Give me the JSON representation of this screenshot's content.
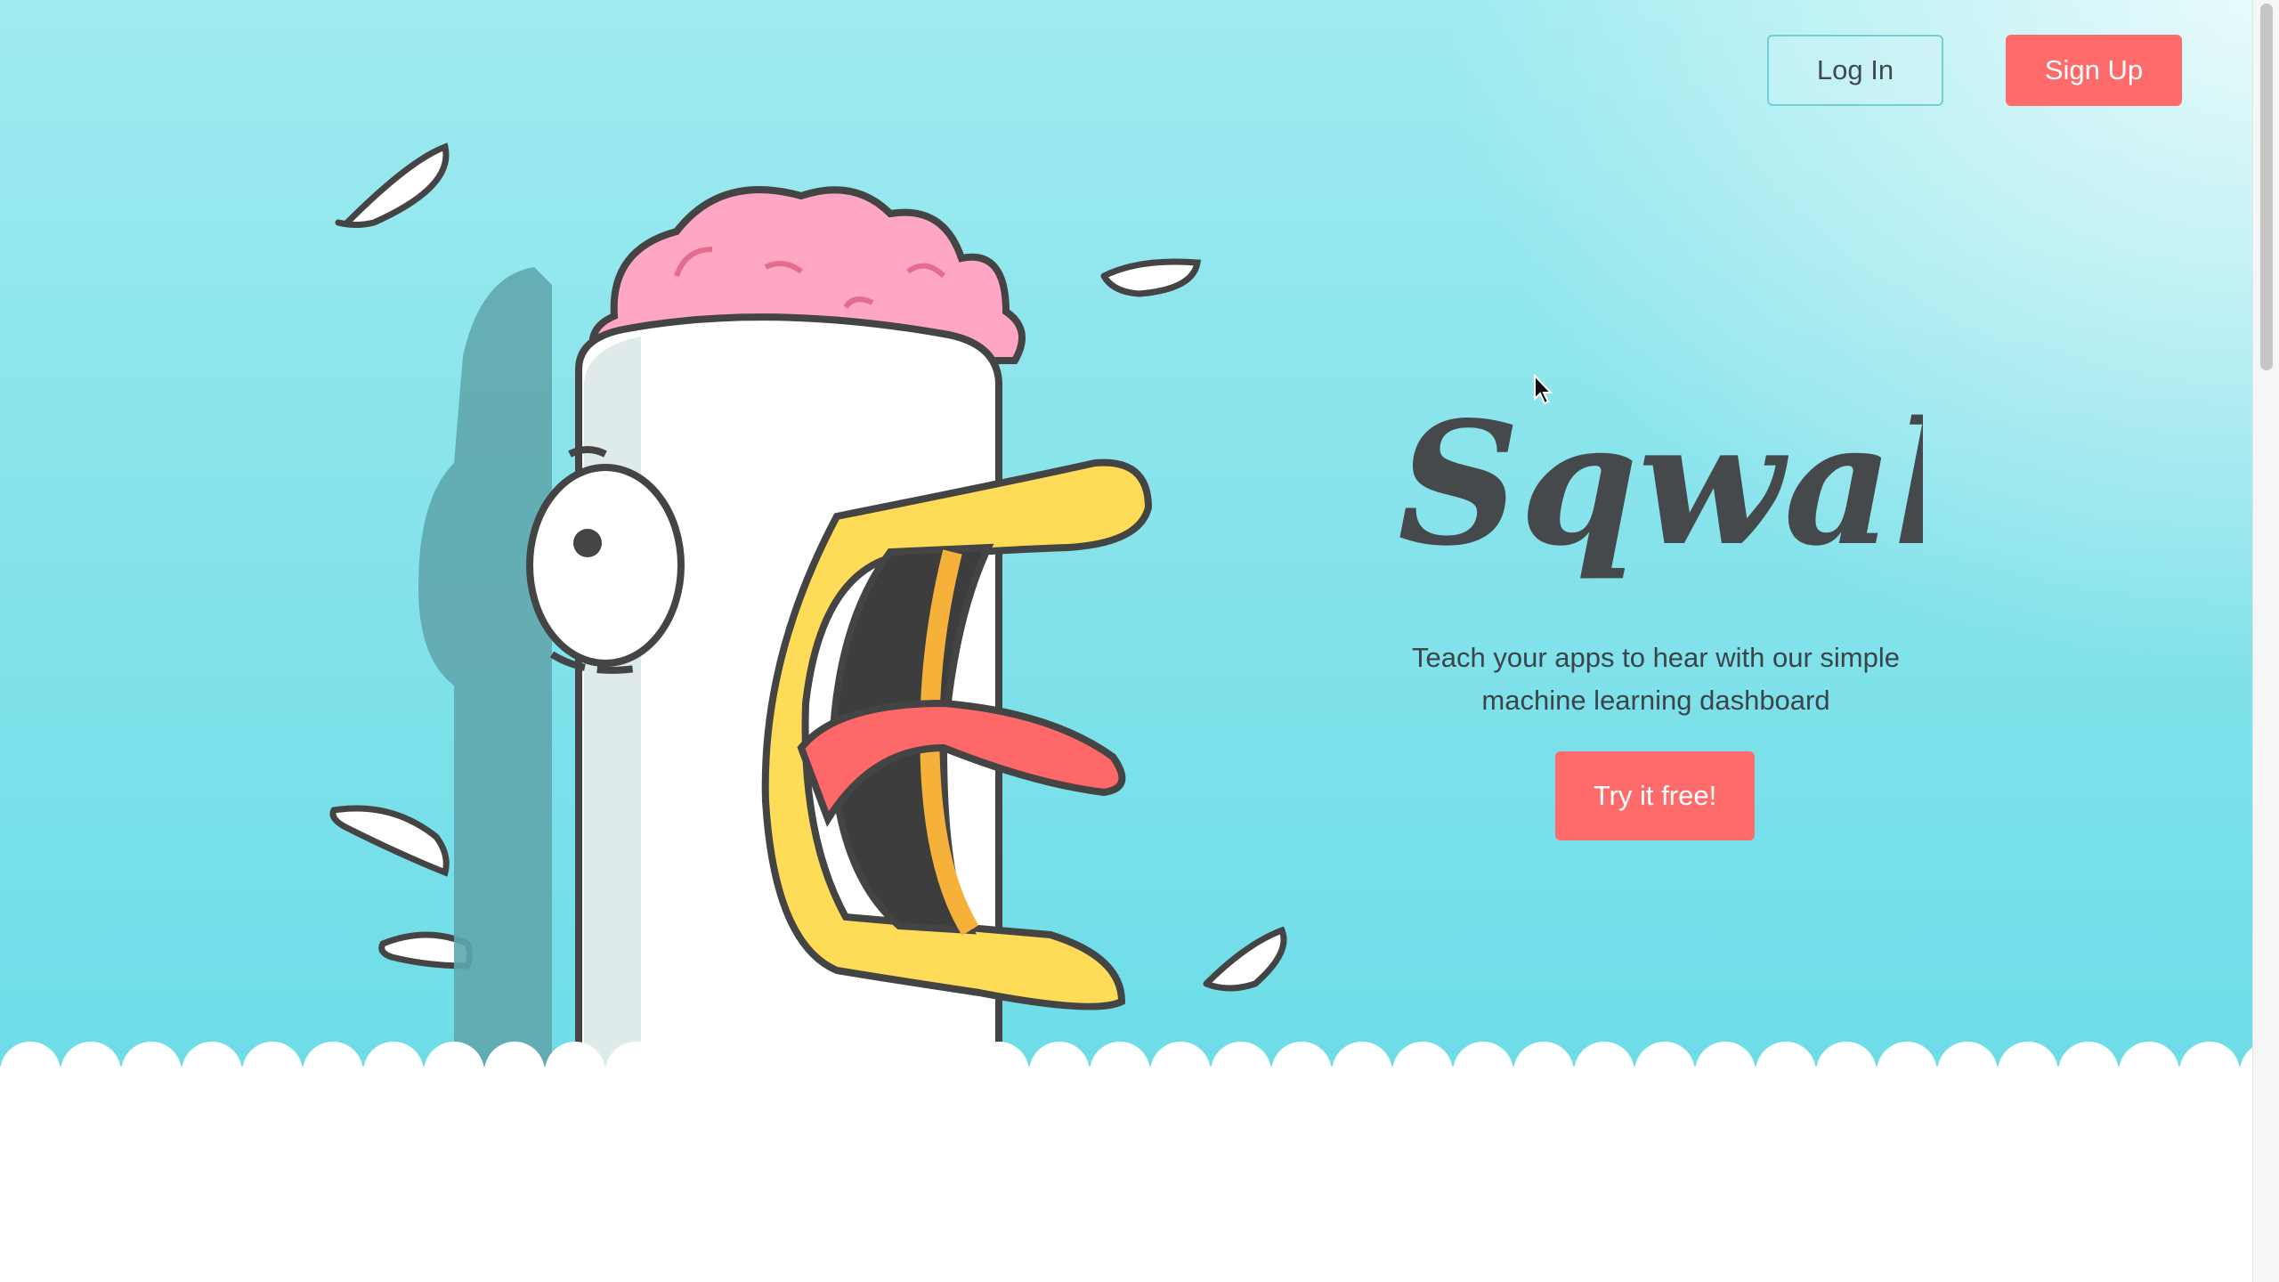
{
  "header": {
    "login_label": "Log In",
    "signup_label": "Sign Up"
  },
  "hero": {
    "brand_name": "Sqwak",
    "tagline_line1": "Teach your apps to hear with our simple",
    "tagline_line2": "machine learning dashboard",
    "cta_label": "Try it free!"
  },
  "colors": {
    "accent": "#ff6a6a",
    "hero_bg": "#8be4ec",
    "text": "#3b4449"
  },
  "icons": [
    "brain-illustration",
    "chicken-mascot",
    "feather-icon",
    "mouse-cursor-icon"
  ]
}
